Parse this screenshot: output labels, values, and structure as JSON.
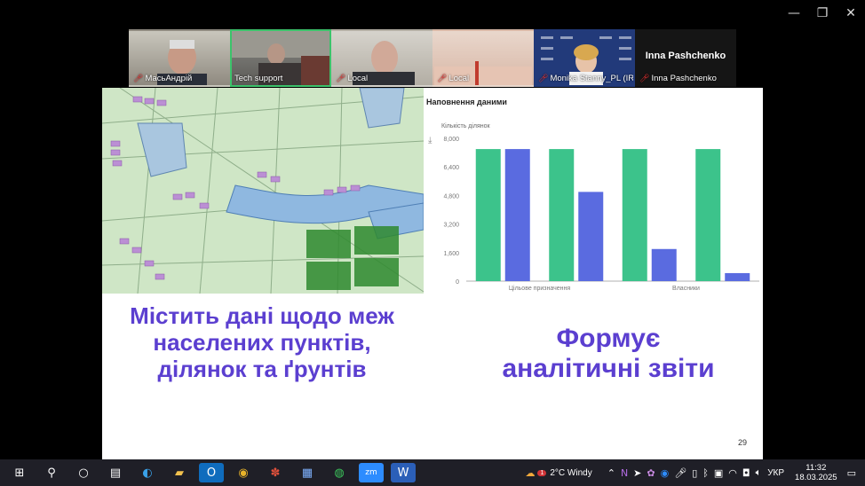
{
  "window_controls": {
    "minimize": "—",
    "restore": "❐",
    "close": "✕"
  },
  "participants": [
    {
      "name": "МасьАндрій",
      "muted": true,
      "active": false
    },
    {
      "name": "Tech support",
      "muted": false,
      "active": true
    },
    {
      "name": "Local",
      "muted": true,
      "active": false
    },
    {
      "name": "Local",
      "muted": true,
      "active": false
    },
    {
      "name": "Monika Stanny_PL (IR...",
      "muted": true,
      "active": false
    },
    {
      "name": "Inna Pashchenko",
      "muted": true,
      "active": false,
      "big_name": "Inna Pashchenko"
    }
  ],
  "slide": {
    "left_text": "Містить дані щодо меж населених пунктів, ділянок та ґрунтів",
    "right_text": "Формує аналітичні звіти",
    "page_number": "29"
  },
  "chart_data": {
    "type": "bar",
    "title": "Наповнення даними",
    "ylabel": "Кількість ділянок",
    "categories": [
      "Цільове призначення",
      "Власники"
    ],
    "yticks": [
      "0",
      "1,600",
      "3,200",
      "4,800",
      "6,400",
      "8,000"
    ],
    "ylim": [
      0,
      8000
    ],
    "colors": [
      "#3cc38b",
      "#5a6be0"
    ],
    "groups": [
      [
        7400,
        7400
      ],
      [
        7400,
        5000
      ],
      [
        7400,
        1800
      ],
      [
        7400,
        450
      ]
    ]
  },
  "taskbar": {
    "weather": "2°C Windy",
    "weather_badge": "1",
    "language": "УКР",
    "time": "11:32",
    "date": "18.03.2025"
  }
}
